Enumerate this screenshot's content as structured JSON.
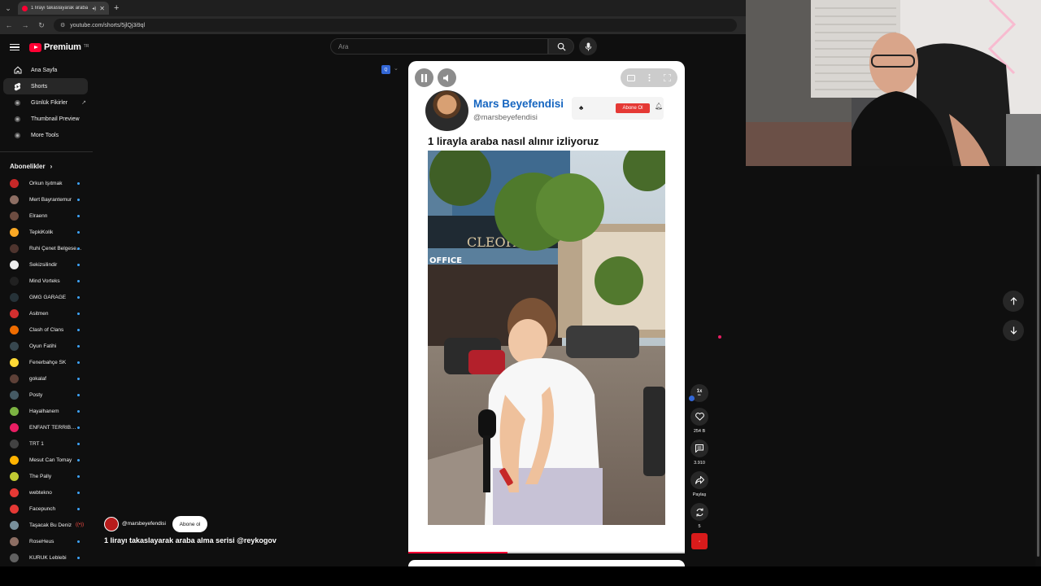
{
  "browser": {
    "tab_title": "1 lirayı takaslayarak araba a…",
    "url": "youtube.com/shorts/5jlQj3i9ql"
  },
  "header": {
    "logo_text": "Premium",
    "logo_region": "TR",
    "search_placeholder": "Ara"
  },
  "sidebar": {
    "items": [
      {
        "label": "Ana Sayfa",
        "icon": "home-icon"
      },
      {
        "label": "Shorts",
        "icon": "shorts-icon"
      },
      {
        "label": "Günlük Fikirler",
        "icon": "circle-icon"
      },
      {
        "label": "Thumbnail Preview",
        "icon": "circle-icon"
      },
      {
        "label": "More Tools",
        "icon": "circle-icon"
      }
    ],
    "subscriptions_heading": "Abonelikler",
    "subscriptions": [
      {
        "name": "Orkun Işıtmak",
        "color": "#c62828",
        "indicator": "dot"
      },
      {
        "name": "Mert Bayrantemur",
        "color": "#8d6e63",
        "indicator": "dot"
      },
      {
        "name": "Elraenn",
        "color": "#6d4c41",
        "indicator": "dot"
      },
      {
        "name": "TepkiKolik",
        "color": "#f9a825",
        "indicator": "dot"
      },
      {
        "name": "Ruhi Çenet Belgese…",
        "color": "#4e342e",
        "indicator": "dot"
      },
      {
        "name": "Sekizsilindir",
        "color": "#eeeeee",
        "indicator": "dot"
      },
      {
        "name": "Mind Vorteks",
        "color": "#212121",
        "indicator": "dot"
      },
      {
        "name": "GMG GARAGE",
        "color": "#263238",
        "indicator": "dot"
      },
      {
        "name": "Asitmen",
        "color": "#d32f2f",
        "indicator": "dot"
      },
      {
        "name": "Clash of Clans",
        "color": "#ef6c00",
        "indicator": "dot"
      },
      {
        "name": "Oyun Fatihi",
        "color": "#37474f",
        "indicator": "dot"
      },
      {
        "name": "Fenerbahçe SK",
        "color": "#fdd835",
        "indicator": "dot"
      },
      {
        "name": "gokalaf",
        "color": "#5d4037",
        "indicator": "dot"
      },
      {
        "name": "Posty",
        "color": "#455a64",
        "indicator": "dot"
      },
      {
        "name": "Hayalhanem",
        "color": "#7cb342",
        "indicator": "dot"
      },
      {
        "name": "ENFANT TERRIB…",
        "color": "#e91e63",
        "indicator": "dot"
      },
      {
        "name": "TRT 1",
        "color": "#424242",
        "indicator": "dot"
      },
      {
        "name": "Mesut Can Tomay",
        "color": "#ffb300",
        "indicator": "dot"
      },
      {
        "name": "The Pally",
        "color": "#c0ca33",
        "indicator": "dot"
      },
      {
        "name": "webtekno",
        "color": "#e53935",
        "indicator": "dot"
      },
      {
        "name": "Facepunch",
        "color": "#e53935",
        "indicator": "dot"
      },
      {
        "name": "Taşacak Bu Deniz",
        "color": "#78909c",
        "indicator": "live"
      },
      {
        "name": "RoseHeus",
        "color": "#8d6e63",
        "indicator": "dot"
      },
      {
        "name": "KURUK Leblebi",
        "color": "#616161",
        "indicator": "dot"
      }
    ]
  },
  "short": {
    "channel_name": "Mars Beyefendisi",
    "channel_handle": "@marsbeyefendisi",
    "subscribe_label": "Abone Ol",
    "video_headline": "1 lirayla araba nasıl alınır izliyoruz",
    "overlay_handle": "@marsbeyefendisi",
    "overlay_subscribe": "Abone ol",
    "overlay_title": "1 lirayı takaslayarak araba alma serisi @reykogov",
    "progress": 0.36
  },
  "actions": {
    "speed": "1x",
    "likes": "254 B",
    "comments": "3.910",
    "share": "Paylaş",
    "remix": "5"
  },
  "colors": {
    "accent": "#ff0033",
    "link": "#1565c0"
  }
}
